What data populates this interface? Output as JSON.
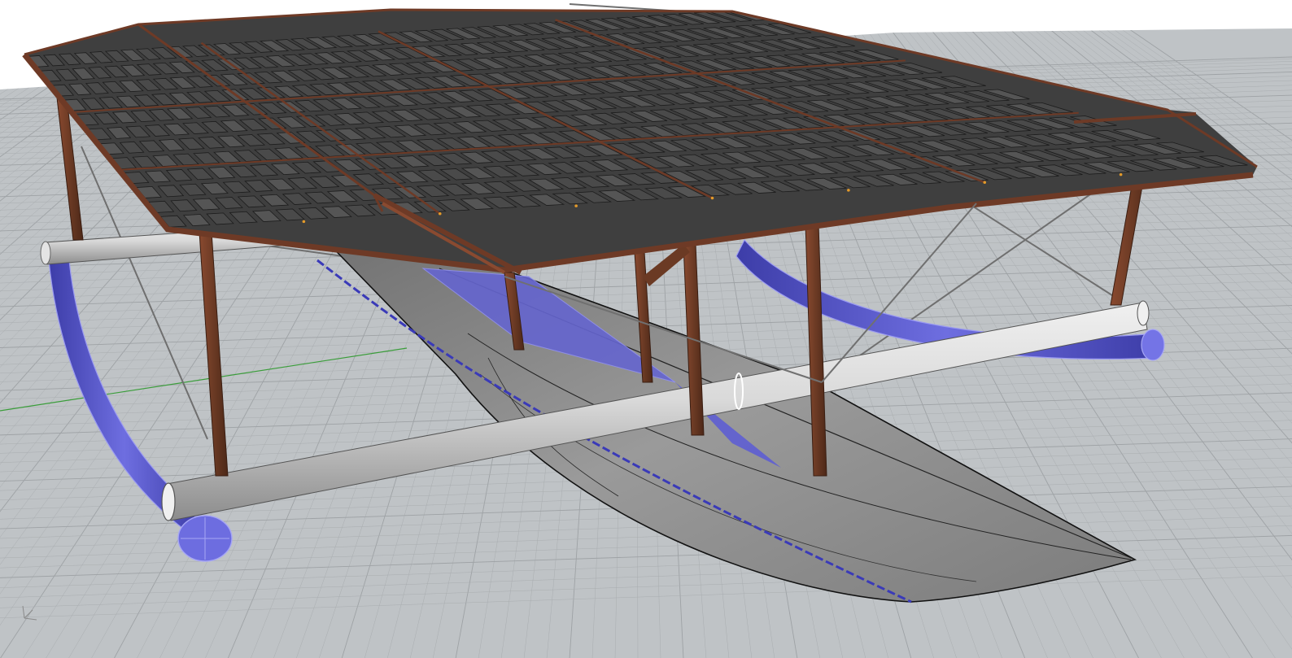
{
  "viewport": {
    "view_type": "Perspective",
    "display_mode": "Shaded",
    "grid_visible": true,
    "world_axes_icon": "world-axes-icon",
    "axis_label_text": ""
  },
  "model": {
    "roof": {
      "material_color": "#6e3a26",
      "cell_color": "#4a4a4a",
      "cell_edge_color": "#1c1c1c"
    },
    "posts": {
      "color": "#6b3a24"
    },
    "cross_beams": {
      "color": "#d6d6d6"
    },
    "hull": {
      "color": "#8d8d8d"
    },
    "pontoons": {
      "color": "#5a5ad6",
      "highlight": "#8f8ff0"
    }
  },
  "colors": {
    "grid_background": "#bfc3c6",
    "grid_line": "#a9adb0",
    "grid_major": "#9ea2a5",
    "x_axis": "#3a9d3a",
    "selection": "#5b5bff"
  }
}
